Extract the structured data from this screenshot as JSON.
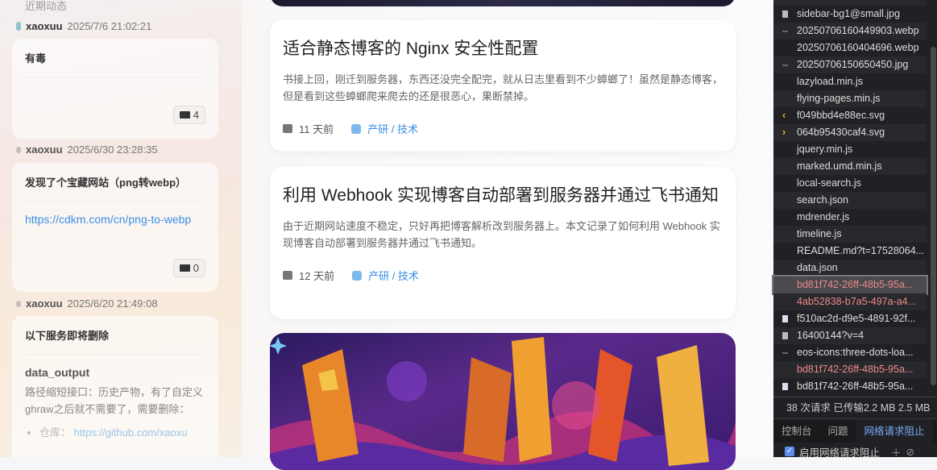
{
  "sidebar": {
    "section_title": "近期动态",
    "entries": [
      {
        "user": "xaoxuu",
        "time": "2025/7/6 21:02:21",
        "title": "有毒",
        "comments": "4"
      },
      {
        "user": "xaoxuu",
        "time": "2025/6/30 23:28:35",
        "title": "发现了个宝藏网站（png转webp）",
        "link": "https://cdkm.com/cn/png-to-webp",
        "comments": "0"
      },
      {
        "user": "xaoxuu",
        "time": "2025/6/20 21:49:08",
        "title": "以下服务即将删除",
        "subtitle": "data_output",
        "body": "路径缩短接口：历史产物，有了自定义ghraw之后就不需要了，需要删除：",
        "list_label": "仓库：",
        "list_link": "https://github.com/xaoxu"
      }
    ]
  },
  "posts": [
    {
      "title": "适合静态博客的 Nginx 安全性配置",
      "excerpt": "书接上回，刚迁到服务器，东西还没完全配完，就从日志里看到不少蟑螂了！虽然是静态博客，但是看到这些蟑螂爬来爬去的还是很恶心，果断禁掉。",
      "date": "11 天前",
      "category": "产研 / 技术"
    },
    {
      "title": "利用 Webhook 实现博客自动部署到服务器并通过飞书通知",
      "excerpt": "由于近期网站速度不稳定，只好再把博客解析改到服务器上。本文记录了如何利用 Webhook 实现博客自动部署到服务器并通过飞书通知。",
      "date": "12 天前",
      "category": "产研 / 技术"
    }
  ],
  "devtools": {
    "requests": [
      {
        "name": "",
        "type": "other"
      },
      {
        "name": "sidebar-bg1@small.jpg",
        "type": "image"
      },
      {
        "name": "20250706160449903.webp",
        "type": "other"
      },
      {
        "name": "20250706160404696.webp",
        "type": "none"
      },
      {
        "name": "20250706150650450.jpg",
        "type": "other"
      },
      {
        "name": "lazyload.min.js",
        "type": "none"
      },
      {
        "name": "flying-pages.min.js",
        "type": "none"
      },
      {
        "name": "f049bbd4e88ec.svg",
        "type": "svg-left"
      },
      {
        "name": "064b95430caf4.svg",
        "type": "svg-right"
      },
      {
        "name": "jquery.min.js",
        "type": "none"
      },
      {
        "name": "marked.umd.min.js",
        "type": "none"
      },
      {
        "name": "local-search.js",
        "type": "none"
      },
      {
        "name": "search.json",
        "type": "none"
      },
      {
        "name": "mdrender.js",
        "type": "none"
      },
      {
        "name": "timeline.js",
        "type": "none"
      },
      {
        "name": "README.md?t=17528064...",
        "type": "none"
      },
      {
        "name": "data.json",
        "type": "none"
      },
      {
        "name": "bd81f742-26ff-48b5-95a...",
        "type": "blocked",
        "selected": true
      },
      {
        "name": "4ab52838-b7a5-497a-a4...",
        "type": "blocked"
      },
      {
        "name": "f510ac2d-d9e5-4891-92f...",
        "type": "doc"
      },
      {
        "name": "16400144?v=4",
        "type": "image"
      },
      {
        "name": "eos-icons:three-dots-loa...",
        "type": "other"
      },
      {
        "name": "bd81f742-26ff-48b5-95a...",
        "type": "blocked"
      },
      {
        "name": "bd81f742-26ff-48b5-95a...",
        "type": "doc"
      }
    ],
    "status": "38 次请求  已传输2.2 MB  2.5 MB",
    "tabs": [
      "控制台",
      "问题",
      "网络请求阻止"
    ],
    "enable_blocking": "启用网络请求阻止",
    "colors": {
      "bg": "#202124",
      "blocked": "#ee8a8a",
      "accent": "#7cacf8"
    }
  }
}
